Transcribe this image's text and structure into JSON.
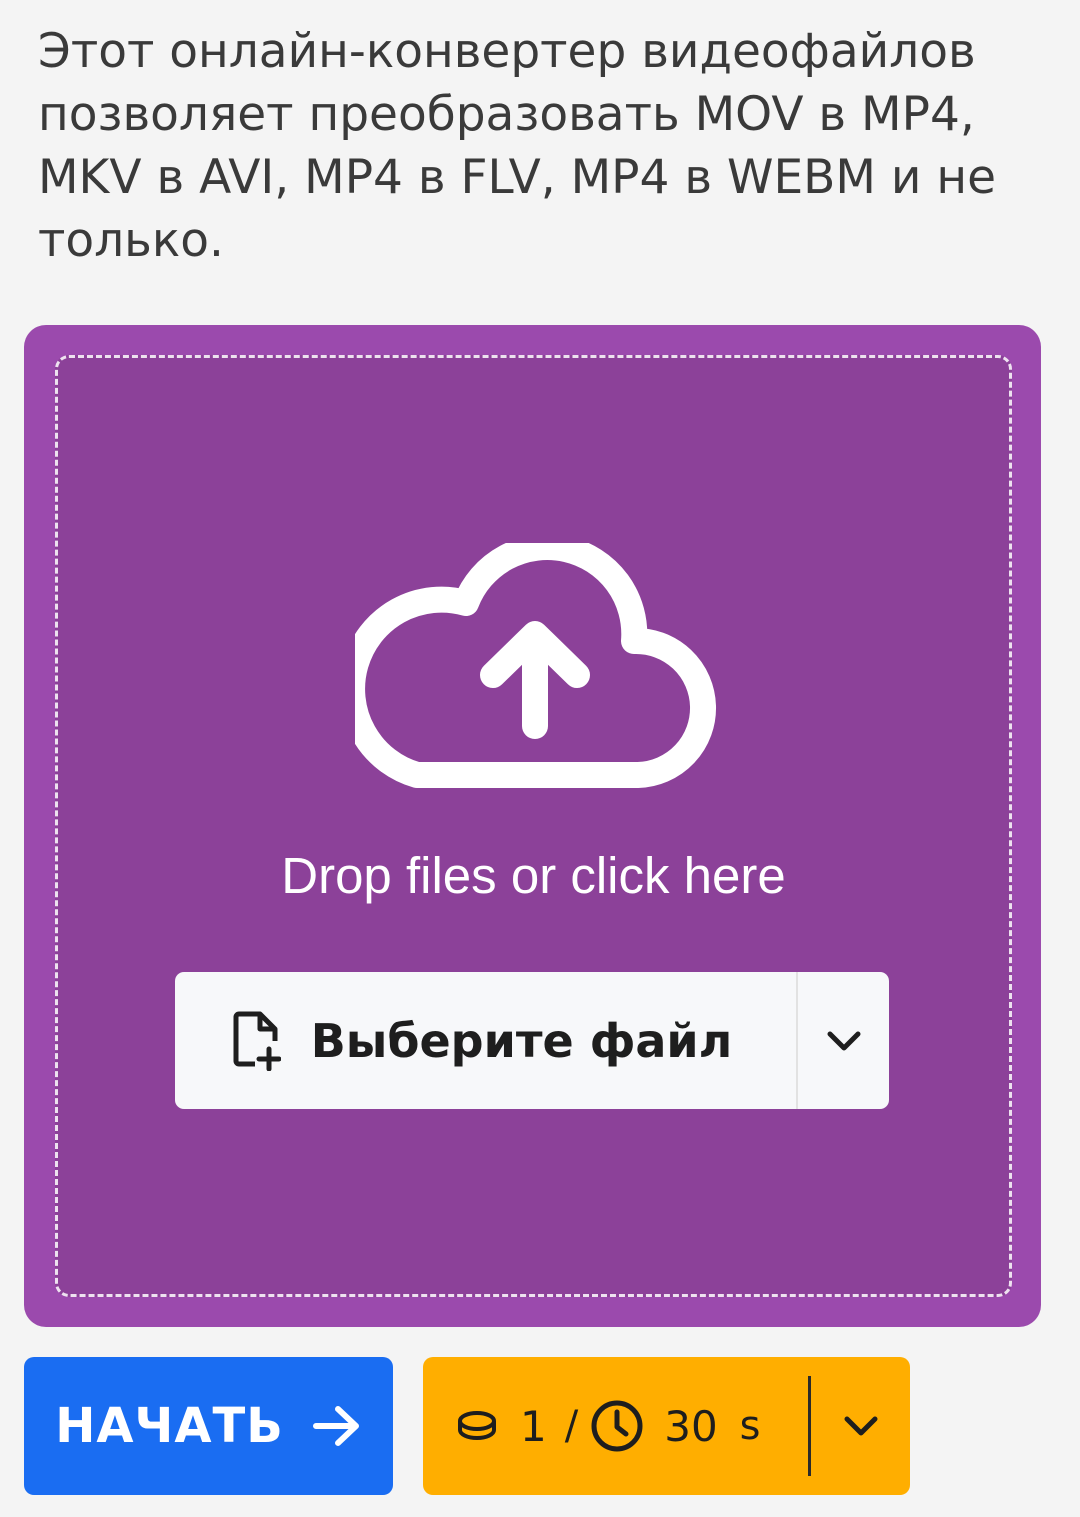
{
  "intro": {
    "text": "Этот онлайн-конвертер видеофайлов позволяет преобразовать MOV в MP4, MKV в AVI, MP4 в FLV, MP4 в WEBM и не только."
  },
  "upload": {
    "background_color": "#9b4aad",
    "dropzone_color": "#8c4199",
    "icon": "cloud-upload-icon",
    "drop_text": "Drop files or click here",
    "choose_file_label": "Выберите файл",
    "choose_file_icon": "file-add-icon",
    "dropdown_icon": "chevron-down-icon"
  },
  "actions": {
    "start_label": "НАЧАТЬ",
    "start_icon": "arrow-right-icon",
    "start_color": "#1a6df2",
    "cost_color": "#ffae00",
    "credits": "1",
    "separator": "/",
    "time_value": "30",
    "time_unit": "s",
    "credits_icon": "coin-icon",
    "time_icon": "clock-icon",
    "dropdown_icon": "chevron-down-icon"
  }
}
